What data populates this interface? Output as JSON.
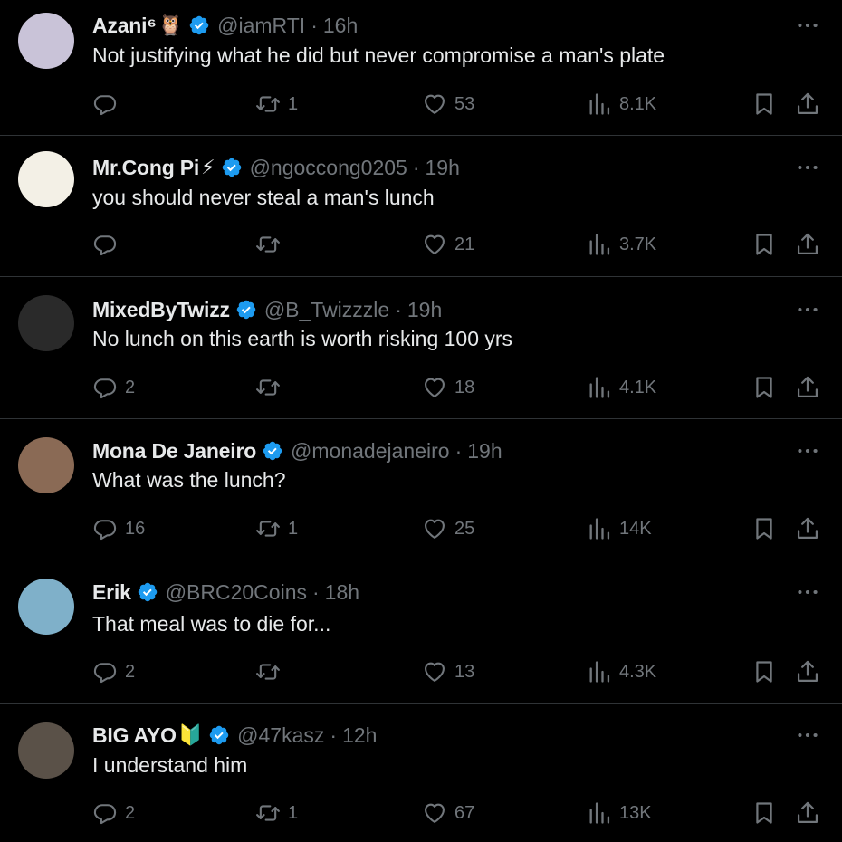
{
  "tweets": [
    {
      "name": "Azani⁶",
      "emoji": "🦉",
      "handle": "@iamRTI",
      "dot": "·",
      "time": "16h",
      "text": "Not justifying what he did but never compromise a man's plate",
      "replies": "",
      "retweets": "1",
      "likes": "53",
      "views": "8.1K",
      "avatar": "#c9c3d8"
    },
    {
      "name": "Mr.Cong Pi",
      "emoji": "⚡",
      "handle": "@ngoccong0205",
      "dot": "·",
      "time": "19h",
      "text": "you should never steal a man's lunch",
      "replies": "",
      "retweets": "",
      "likes": "21",
      "views": "3.7K",
      "avatar": "#f3f0e6"
    },
    {
      "name": "MixedByTwizz",
      "emoji": "",
      "handle": "@B_Twizzzle",
      "dot": "·",
      "time": "19h",
      "text": "No lunch on this earth is worth  risking 100 yrs",
      "replies": "2",
      "retweets": "",
      "likes": "18",
      "views": "4.1K",
      "avatar": "#2a2a2a"
    },
    {
      "name": "Mona De Janeiro",
      "emoji": "",
      "handle": "@monadejaneiro",
      "dot": "·",
      "time": "19h",
      "text": "What was the lunch?",
      "replies": "16",
      "retweets": "1",
      "likes": "25",
      "views": "14K",
      "avatar": "#8a6a55"
    },
    {
      "name": "Erik",
      "emoji": "",
      "handle": "@BRC20Coins",
      "dot": "·",
      "time": "18h",
      "text": "That meal was to die for...",
      "replies": "2",
      "retweets": "",
      "likes": "13",
      "views": "4.3K",
      "avatar": "#7fb0c9"
    },
    {
      "name": "BIG AYO",
      "emoji": "🔰",
      "handle": "@47kasz",
      "dot": "·",
      "time": "12h",
      "text": "I understand him",
      "replies": "2",
      "retweets": "1",
      "likes": "67",
      "views": "13K",
      "avatar": "#5a5148"
    }
  ],
  "colors": {
    "background": "#000000",
    "text": "#e7e9ea",
    "muted": "#71767b",
    "verified": "#1d9bf0",
    "divider": "#2f3336"
  },
  "icons": {
    "verified": "verified-badge-icon",
    "more": "more-options-icon",
    "reply": "reply-icon",
    "retweet": "retweet-icon",
    "like": "heart-icon",
    "views": "views-icon",
    "bookmark": "bookmark-icon",
    "share": "share-icon"
  }
}
